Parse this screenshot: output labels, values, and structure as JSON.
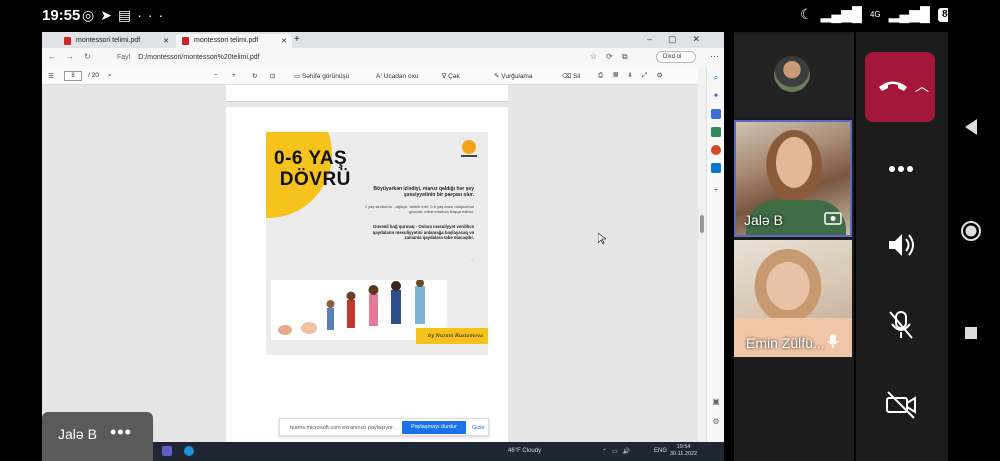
{
  "status_bar": {
    "time": "19:55",
    "network_label": "4G",
    "battery": "87"
  },
  "browser": {
    "tabs": [
      {
        "label": "montessori telimi.pdf"
      },
      {
        "label": "montessori telimi.pdf"
      }
    ],
    "file_label": "Fayl",
    "url": "D:/montessori/montessori%20telimi.pdf",
    "profile_label": "Dixd ol",
    "pdf_toolbar": {
      "page_current": "8",
      "page_total": "/ 20",
      "page_view": "Səhifə görünüşü",
      "read_aloud": "Ucadan oxu",
      "draw": "Çək",
      "highlight": "Vurğulama",
      "erase": "Sil"
    }
  },
  "pdf_page": {
    "title_line1": "0-6 YAŞ",
    "title_line2": "DÖVRÜ",
    "lead": "Böyüyərkən izlədiyi, maruz qaldığı hər şey şəxsiyyətinin bir parçası olur.",
    "p1": "2 yaş sindromu - ağlayır, tantrik edir. 0-6 yaş arası müqavimət göstərir, etiraf edərkən başqa edirlər.",
    "p2": "Güvənli bağ qurmaq - Onlara məsuliyyət verdikcə qaydaların məsuliyyətini anlamağa başlayacaq və zamanla qaydalara tabe olacaqdır.",
    "p3": "...",
    "signature": "by Nurani Rustamova"
  },
  "share_bar": {
    "message": "teams.microsoft.com ekranınızı paylaşıyor.",
    "stop_button": "Paylaşmayı durdur",
    "hide_button": "Gizle"
  },
  "taskbar": {
    "weather": "46°F  Cloudy",
    "language": "ENG",
    "time": "19:54",
    "date": "30.11.2022"
  },
  "self_tile": {
    "name": "Jalə B",
    "more": "•••"
  },
  "participants": [
    {
      "name": "Jalə B"
    },
    {
      "name": "Emin Zülfü..."
    }
  ],
  "colors": {
    "end_call": "#a4173a",
    "active_speaker_border": "#5b6cc8",
    "share_stop": "#1a73e8",
    "slide_yellow": "#f6c21c"
  }
}
